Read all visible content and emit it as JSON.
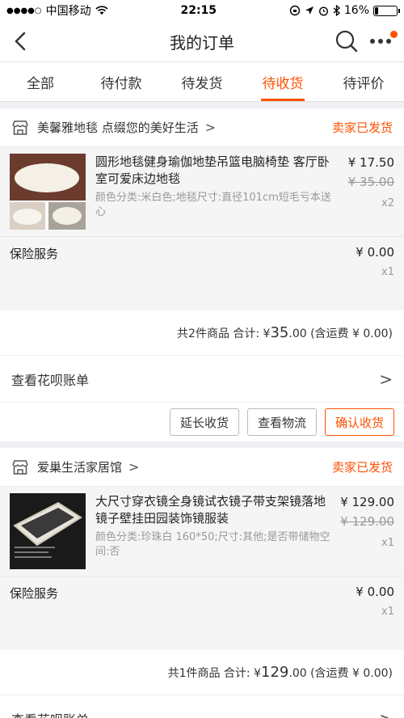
{
  "statusbar": {
    "carrier": "中国移动",
    "time": "22:15",
    "battery": "16%"
  },
  "nav": {
    "title": "我的订单"
  },
  "tabs": [
    {
      "label": "全部"
    },
    {
      "label": "待付款"
    },
    {
      "label": "待发货"
    },
    {
      "label": "待收货",
      "active": true
    },
    {
      "label": "待评价"
    }
  ],
  "orders": [
    {
      "shop": "美馨雅地毯 点缀您的美好生活",
      "status": "卖家已发货",
      "item": {
        "title": "圆形地毯健身瑜伽地垫吊篮电脑椅垫 客厅卧室可爱床边地毯",
        "sku": "颜色分类:米白色;地毯尺寸:直径101cm短毛亏本送心",
        "price": "¥ 17.50",
        "old_price": "¥ 35.00",
        "qty": "x2"
      },
      "insurance": {
        "label": "保险服务",
        "price": "¥ 0.00",
        "qty": "x1"
      },
      "total": {
        "prefix": "共2件商品  合计: ¥ ",
        "big": "35",
        "suffix": ".00 (含运费 ¥ 0.00)"
      },
      "huabei": "查看花呗账单",
      "buttons": {
        "extend": "延长收货",
        "logistics": "查看物流",
        "confirm": "确认收货"
      }
    },
    {
      "shop": "爱巢生活家居馆",
      "status": "卖家已发货",
      "item": {
        "title": "大尺寸穿衣镜全身镜试衣镜子带支架镜落地镜子壁挂田园装饰镜服装",
        "sku": "颜色分类:珍珠白 160*50;尺寸:其他;是否带储物空间:否",
        "price": "¥ 129.00",
        "old_price": "¥ 129.00",
        "qty": "x1"
      },
      "insurance": {
        "label": "保险服务",
        "price": "¥ 0.00",
        "qty": "x1"
      },
      "total": {
        "prefix": "共1件商品  合计: ¥ ",
        "big": "129",
        "suffix": ".00 (含运费 ¥ 0.00)"
      },
      "huabei": "查看花呗账单"
    }
  ],
  "colors": {
    "accent": "#ff5000"
  }
}
